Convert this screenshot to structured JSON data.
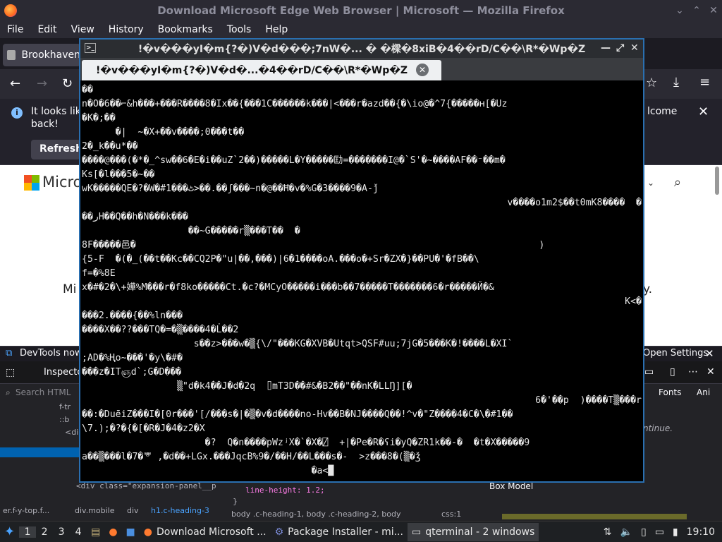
{
  "firefox": {
    "window_title": "Download Microsoft Edge Web Browser | Microsoft — Mozilla Firefox",
    "menu": [
      "File",
      "Edit",
      "View",
      "History",
      "Bookmarks",
      "Tools",
      "Help"
    ],
    "tab_label": "Brookhaven",
    "notification_text": "It looks lik",
    "notification_text2": "back!",
    "notification_right": "lcome",
    "refresh_label": "Refresh",
    "page_logo_text": "Micro",
    "page_mid_left": "Mi",
    "page_mid_right": "y."
  },
  "devtools": {
    "banner": "DevTools now f",
    "open_settings": "Open Settings",
    "inspector_label": "Inspecto",
    "search_placeholder": "Search HTML",
    "fonts_tab": "Fonts",
    "ani_tab": "Ani",
    "continue_text": "ntinue.",
    "box_model": "Box Model",
    "css_line_height": "line-height: 1.2;",
    "css_brace": "}",
    "selector_line": "body .c-heading-1, body .c-heading-2, body",
    "css_file": "css:1",
    "html_snippet": "<div class=\"expansion-panel__p",
    "breadcrumbs": [
      "er.f-y-top.f...",
      "div.mobile",
      "div",
      "h1.c-heading-3"
    ],
    "tree_lines": [
      "f-tr",
      "::b",
      "<di",
      "<"
    ]
  },
  "terminal": {
    "title": "!�v���yI�m{?�)V�d���;7nW�...  � �樑�8xiB�4��rD/C��\\R*�Wp�Z",
    "tab_label": "!�v���yI�m{?�)V�d�...�4��rD/C��\\R*�Wp�Z",
    "lines": [
      {
        "t": "��"
      },
      {
        "t": "n�O�6��⌐&h���+���R����8�Ix��{���1C������k���|<���r�azd��{�\\io@�^7{�����ʜ[�Uz"
      },
      {
        "t": "�K�;��"
      },
      {
        "t": "      �|  ~�X+��v����;0���t��"
      },
      {
        "t": "2�_k��u*��"
      },
      {
        "t": "����@���(�*�_^sw��6�E�i��uZ`2��)�����L�Y�����劻=�������I@�`S'�~����AF��⁻��m�"
      },
      {
        "t": "Ks[�l���5�~��"
      },
      {
        "t": "wK�����QE�?�W�#1���ٹ>��.��ʃ���~n�@��Ħ�v�%G�3����9�A-ǰ"
      },
      {
        "t": "v����o1m2$��t0mK8����  �",
        "right": true
      },
      {
        "t": "��ﺭH��Q��h�N���k���"
      },
      {
        "t": "                   ��~G�����r▒���T��  �"
      },
      {
        "t": "8F�����邑�                                                                        )"
      },
      {
        "t": "{5-F  �(�_(��t��Kc��CQ2P�\"u|��,���)|6�1����oA.���o�+Sr�ZX�}��PU�'�fB��\\"
      },
      {
        "t": "f=�%8E"
      },
      {
        "t": "x�#�2�\\+嬅%M���r�f8ko�����Ct.�c?�MCyO�����i���b��7�����T�������6�r�����Й�&"
      },
      {
        "t": "K<�",
        "right": true
      },
      {
        "t": "���2.����{��%ln���"
      },
      {
        "t": "����X��??���TQ�=�▒����4�L̇��2"
      },
      {
        "t": "                    s��z>���w�▒{\\/\"���KG�XVB�Utqt>QSF#uu;7jG�5���K�!����L�XI`"
      },
      {
        "t": ";AD�%Ңo~���'�y\\�#�"
      },
      {
        "t": "���z�ITஞd`;G�D���"
      },
      {
        "t": "                 ▒\"d�k4��J�d�2q  ⌷mT3D��#&�B2��\"��nK�LLŊ][�"
      },
      {
        "t": "6�'��p  )����T▒���r",
        "right": true
      },
      {
        "t": "��:�DuēiZ���I�[0r���'[/���s�|�▒�v�d����no-Hv��B�NJ����Q��!^v�\"Z����4�C�\\�#1��"
      },
      {
        "t": "\\7.);�?�{�[�R�J�4�z2�X"
      },
      {
        "t": "                      �?  Q�n����pWzʲX�`�X�⍁  +|�Pe�R�ʕi�yQ�ZR1k��-�  �t�X�����9"
      },
      {
        "t": "a��▒���l�7�ᄬ ,�d��+LGx.���JqcB%9�/��H/��L���s�-  >z���8�(▒�ǯ"
      },
      {
        "t": "                                         �a<█"
      }
    ]
  },
  "taskbar": {
    "workspaces": [
      "1",
      "2",
      "3",
      "4"
    ],
    "tasks": [
      "Download Microsoft ...",
      "Package Installer - mi...",
      "qterminal - 2 windows"
    ],
    "clock": "19:10"
  },
  "colors": {
    "term_border": "#2a6fb0",
    "ff_bg": "#2b2a33",
    "terminal_bg": "#000000"
  }
}
